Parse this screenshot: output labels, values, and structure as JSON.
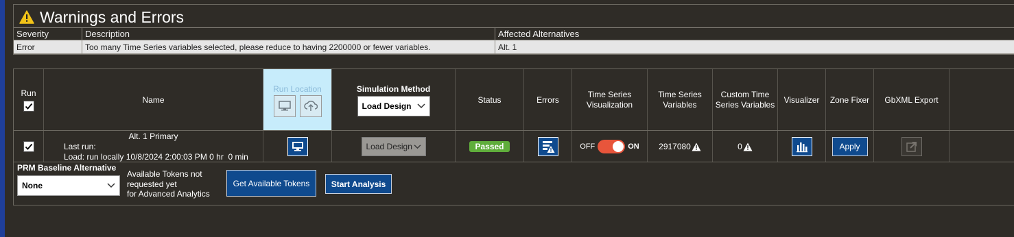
{
  "warnings": {
    "title": "Warnings and Errors",
    "columns": [
      "Severity",
      "Description",
      "Affected Alternatives"
    ],
    "rows": [
      {
        "severity": "Error",
        "description": "Too many Time Series variables selected, please reduce to having 2200000 or fewer variables.",
        "affected": "Alt. 1"
      }
    ]
  },
  "table": {
    "headers": {
      "run": "Run",
      "name": "Name",
      "run_location": "Run Location",
      "simulation_method": "Simulation Method",
      "status": "Status",
      "errors": "Errors",
      "ts_vis_1": "Time Series",
      "ts_vis_2": "Visualization",
      "ts_vars_1": "Time Series",
      "ts_vars_2": "Variables",
      "custom_ts_1": "Custom Time",
      "custom_ts_2": "Series Variables",
      "visualizer": "Visualizer",
      "zone_fixer": "Zone Fixer",
      "gbxml_export": "GbXML Export"
    },
    "header_sim_select": "Load Design",
    "row": {
      "name": "Alt. 1 Primary",
      "last_run": "Last run:",
      "load_run": "Load: run locally 10/8/2024 2:00:03 PM 0 hr  0 min",
      "sim_method": "Load Design",
      "status": "Passed",
      "toggle_off": "OFF",
      "toggle_on": "ON",
      "ts_variables": "2917080",
      "custom_ts_variables": "0",
      "apply": "Apply"
    }
  },
  "prm": {
    "label": "PRM Baseline Alternative",
    "selected": "None",
    "tokens_line1": "Available Tokens not",
    "tokens_line2": "requested yet",
    "tokens_line3": "for Advanced Analytics",
    "get_tokens": "Get Available Tokens",
    "start_analysis": "Start Analysis"
  },
  "colors": {
    "background": "#2f2c27",
    "accent_blue": "#0f4a8e",
    "passed_green": "#5fad3b",
    "toggle_red": "#e8553b",
    "run_location_bg": "#c7ecfb"
  },
  "icons": [
    "warning-triangle-icon",
    "monitor-icon",
    "cloud-upload-icon",
    "errors-report-icon",
    "bar-chart-icon",
    "export-arrow-icon",
    "chevron-down-icon",
    "checkmark-icon"
  ]
}
